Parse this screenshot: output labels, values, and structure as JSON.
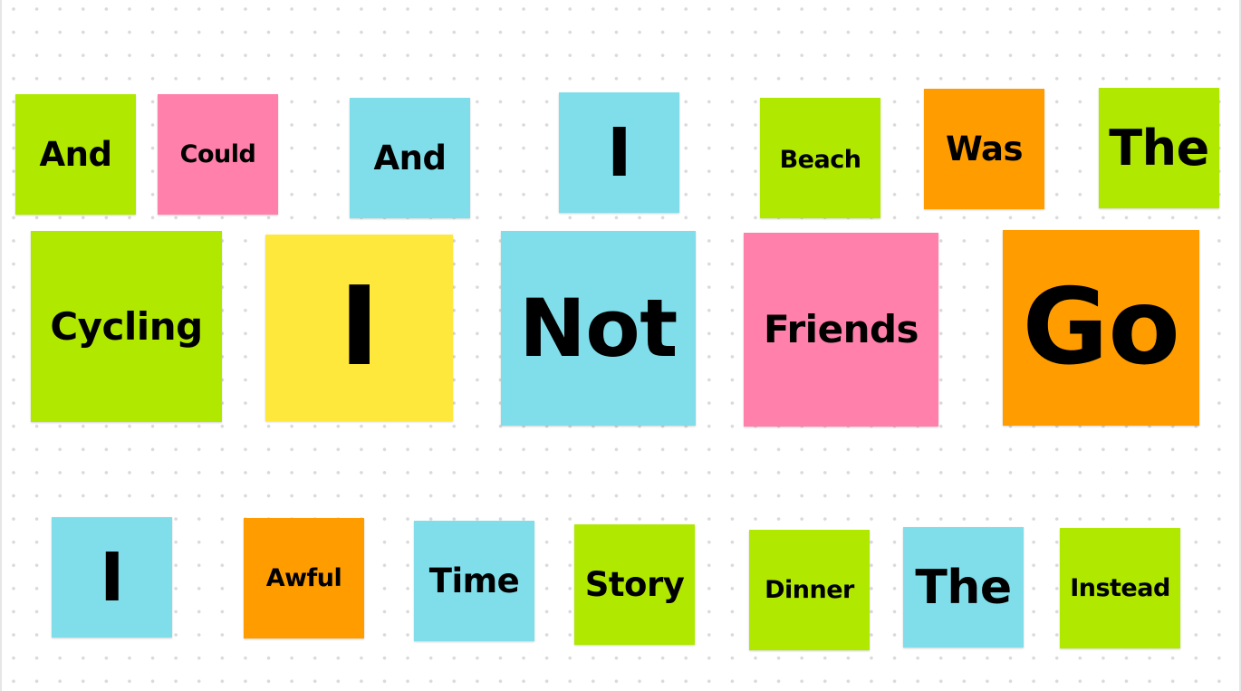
{
  "board": {
    "colors": {
      "green": "#b0e800",
      "pink": "#ff80aa",
      "blue": "#80deea",
      "yellow": "#ffe83c",
      "orange": "#ff9d00",
      "text": "#000000",
      "dot": "#d9d9d9"
    },
    "rows": [
      {
        "notes": [
          {
            "text": "And",
            "color": "green"
          },
          {
            "text": "Could",
            "color": "pink"
          },
          {
            "text": "And",
            "color": "blue"
          },
          {
            "text": "I",
            "color": "blue"
          },
          {
            "text": "Beach",
            "color": "green"
          },
          {
            "text": "Was",
            "color": "orange"
          },
          {
            "text": "The",
            "color": "green"
          }
        ]
      },
      {
        "notes": [
          {
            "text": "Cycling",
            "color": "green"
          },
          {
            "text": "I",
            "color": "yellow"
          },
          {
            "text": "Not",
            "color": "blue"
          },
          {
            "text": "Friends",
            "color": "pink"
          },
          {
            "text": "Go",
            "color": "orange"
          }
        ]
      },
      {
        "notes": [
          {
            "text": "I",
            "color": "blue"
          },
          {
            "text": "Awful",
            "color": "orange"
          },
          {
            "text": "Time",
            "color": "blue"
          },
          {
            "text": "Story",
            "color": "green"
          },
          {
            "text": "Dinner",
            "color": "green"
          },
          {
            "text": "The",
            "color": "blue"
          },
          {
            "text": "Instead",
            "color": "green"
          }
        ]
      }
    ]
  }
}
